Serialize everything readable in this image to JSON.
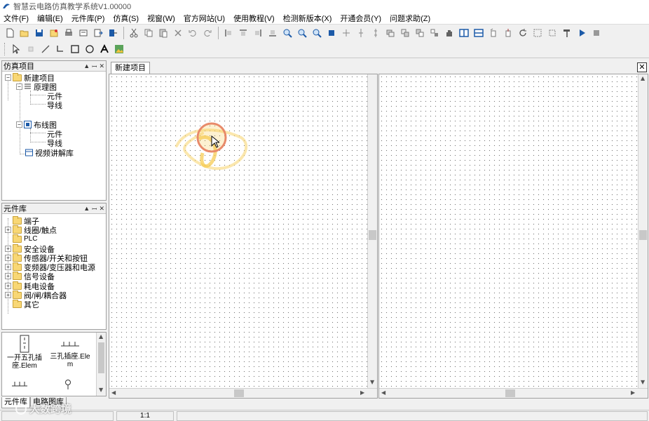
{
  "window": {
    "title": "智慧云电路仿真教学系统V1.00000"
  },
  "menu": [
    "文件(F)",
    "编辑(E)",
    "元件库(P)",
    "仿真(S)",
    "视窗(W)",
    "官方网站(U)",
    "使用教程(V)",
    "检测新版本(X)",
    "开通会员(Y)",
    "问题求助(Z)"
  ],
  "sim_panel": {
    "title": "仿真项目",
    "root": "新建项目",
    "schematic": "原理图",
    "schematic_children": [
      "元件",
      "导线"
    ],
    "wiring": "布线图",
    "wiring_children": [
      "元件",
      "导线"
    ],
    "video": "视频讲解库"
  },
  "lib_panel": {
    "title": "元件库",
    "items": [
      "端子",
      "线圈/触点",
      "PLC",
      "安全设备",
      "传感器/开关和按钮",
      "变频器/变压器和电源",
      "信号设备",
      "耗电设备",
      "阀/闸/耦合器",
      "其它"
    ]
  },
  "parts": [
    {
      "name": "一开五孔插座.Elem"
    },
    {
      "name": "三孔插座.Elem"
    }
  ],
  "bottom_tabs": [
    "元件库",
    "电路图库"
  ],
  "doc_tab": "新建项目",
  "status": {
    "zoom": "1:1"
  },
  "watermark": "大数跨境",
  "colors": {
    "accent": "#1c5aa8",
    "highlight": "#f7c948",
    "cursor_ring": "#e88a6a"
  }
}
